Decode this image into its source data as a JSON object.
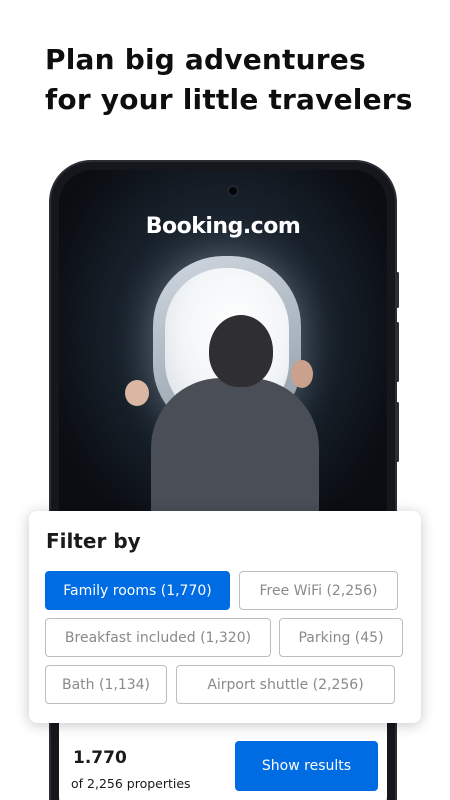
{
  "headline": {
    "line1": "Plan big adventures",
    "line2": "for your little travelers"
  },
  "phone": {
    "brand": "Booking.com",
    "results": {
      "count": "1.770",
      "subtitle": "of 2,256 properties",
      "button_label": "Show results"
    }
  },
  "filter": {
    "title": "Filter by",
    "chips": [
      {
        "label": "Family rooms (1,770)",
        "active": true
      },
      {
        "label": "Free WiFi (2,256)",
        "active": false
      },
      {
        "label": "Breakfast included (1,320)",
        "active": false
      },
      {
        "label": "Parking (45)",
        "active": false
      },
      {
        "label": "Bath (1,134)",
        "active": false
      },
      {
        "label": "Airport shuttle (2,256)",
        "active": false
      }
    ]
  },
  "colors": {
    "accent": "#006ce4",
    "chip_border": "#bdbdbd",
    "text": "#1a1a1a"
  }
}
